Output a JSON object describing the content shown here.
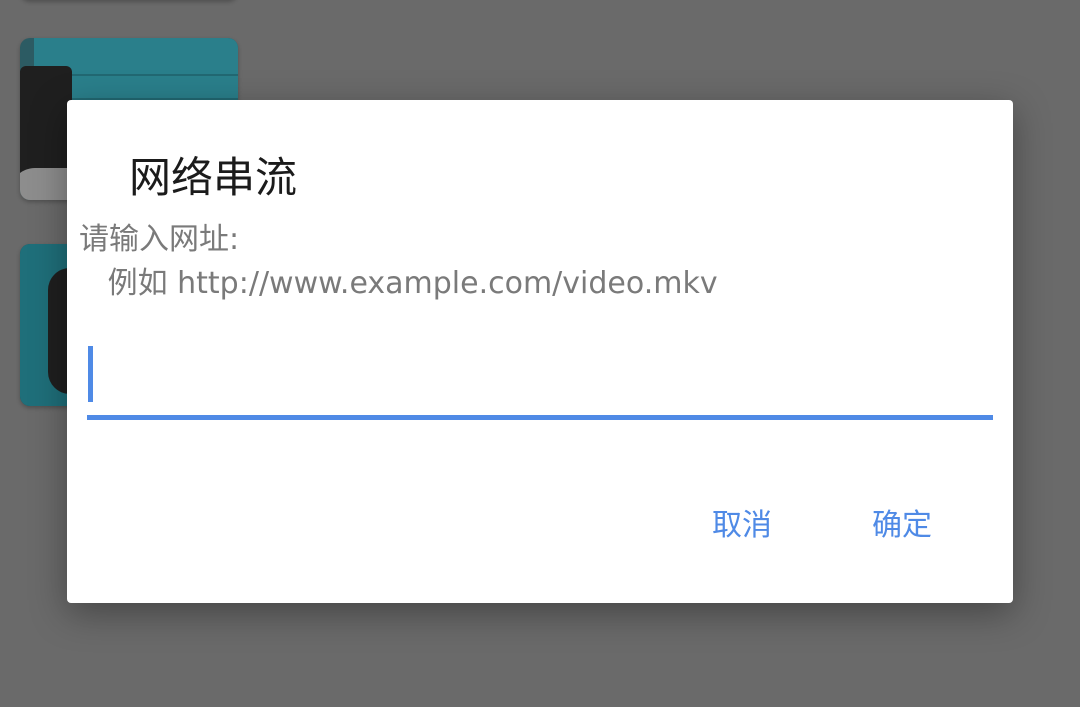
{
  "dialog": {
    "title": "网络串流",
    "message": "请输入网址:\n   例如 http://www.example.com/video.mkv",
    "input_value": "",
    "input_placeholder": "",
    "cancel_label": "取消",
    "ok_label": "确定"
  },
  "colors": {
    "accent": "#4f8ae6",
    "overlay": "#6a6a6a",
    "dialog_bg": "#ffffff"
  },
  "background": {
    "thumbnails": [
      "video-thumbnail",
      "video-thumbnail"
    ]
  }
}
